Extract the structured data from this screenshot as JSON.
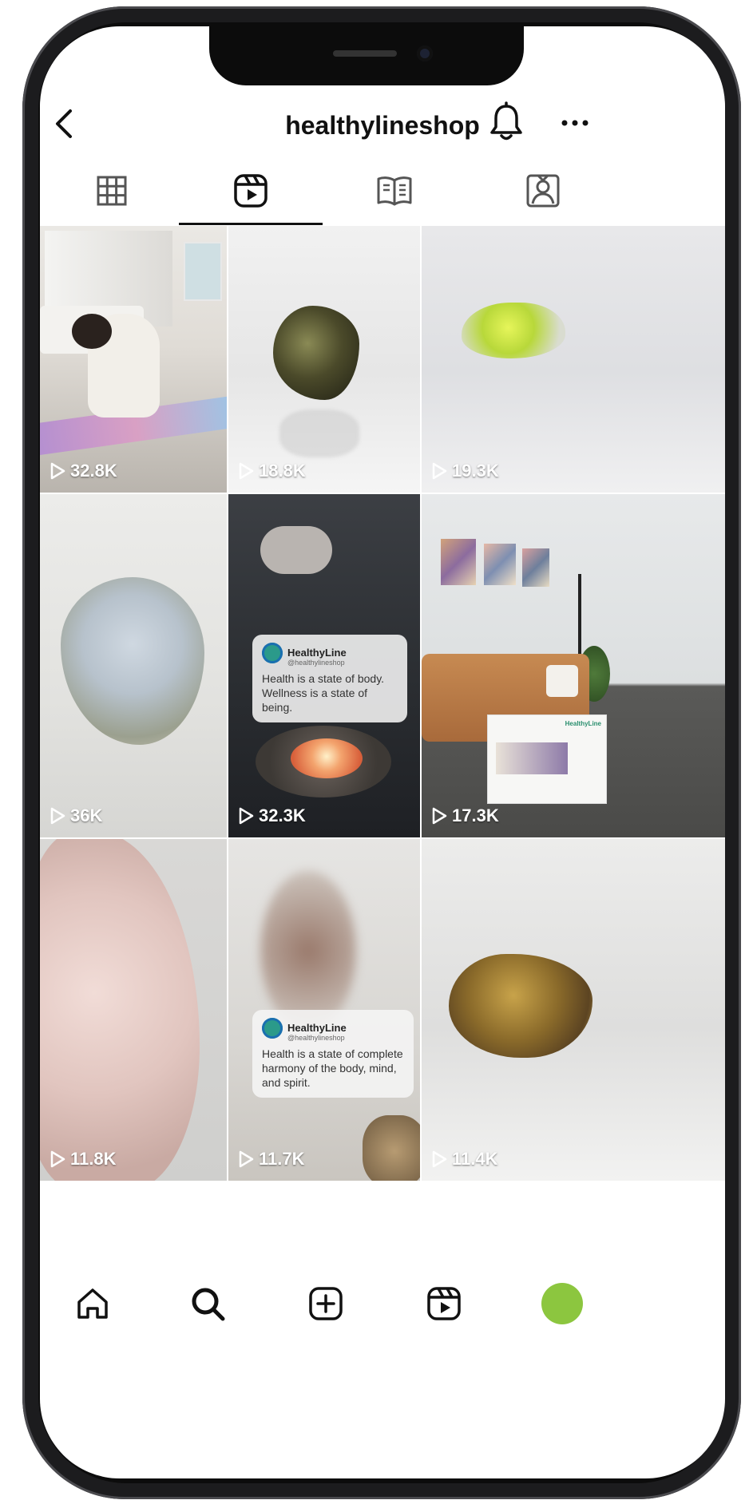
{
  "header": {
    "username": "healthylineshop"
  },
  "tabs": [
    {
      "name": "grid",
      "active": false
    },
    {
      "name": "reels",
      "active": true
    },
    {
      "name": "guides",
      "active": false
    },
    {
      "name": "tagged",
      "active": false
    }
  ],
  "reels": [
    {
      "views": "32.8K",
      "subject": "woman doing yoga stretch on mat"
    },
    {
      "views": "18.8K",
      "subject": "pyrite crystal"
    },
    {
      "views": "19.3K",
      "subject": "green crystal cluster"
    },
    {
      "views": "36K",
      "subject": "celestite geode"
    },
    {
      "views": "32.3K",
      "subject": "hand and candle"
    },
    {
      "views": "17.3K",
      "subject": "living room with product box"
    },
    {
      "views": "11.8K",
      "subject": "pink crystal"
    },
    {
      "views": "11.7K",
      "subject": "meditation with incense"
    },
    {
      "views": "11.4K",
      "subject": "amber crystal"
    }
  ],
  "post_cards": [
    {
      "brand": "HealthyLine",
      "handle": "@healthylineshop",
      "message": "Health is a state of body. Wellness is a state of being."
    },
    {
      "brand": "HealthyLine",
      "handle": "@healthylineshop",
      "message": "Health is a state of complete harmony of the body, mind, and spirit."
    }
  ],
  "product_box": {
    "brand": "HealthyLine"
  },
  "colors": {
    "avatar": "#8cc63f",
    "accent": "#111111"
  },
  "icons": [
    "back-icon",
    "bell-icon",
    "more-icon",
    "grid-icon",
    "reels-icon",
    "guides-icon",
    "tagged-icon",
    "home-icon",
    "search-icon",
    "create-icon",
    "reels-nav-icon",
    "avatar"
  ]
}
